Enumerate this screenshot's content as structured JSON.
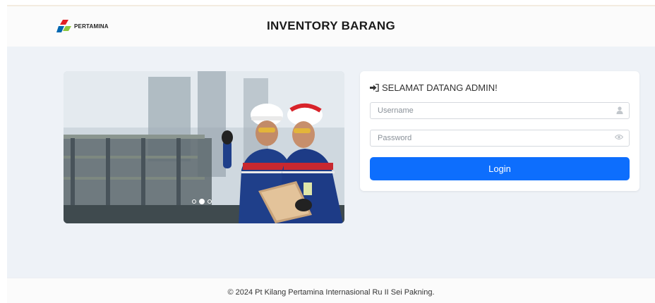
{
  "header": {
    "logo_text": "PERTAMINA",
    "title": "INVENTORY BARANG"
  },
  "carousel": {
    "image_icon": "pertamina-workers-photo",
    "slide_count": 3,
    "active_slide": 2
  },
  "login": {
    "title_icon": "sign-in-icon",
    "title": "SELAMAT DATANG ADMIN!",
    "username_placeholder": "Username",
    "username_value": "",
    "username_icon": "user-icon",
    "password_placeholder": "Password",
    "password_value": "",
    "password_icon": "eye-icon",
    "button_label": "Login"
  },
  "footer": {
    "text": "© 2024 Pt Kilang Pertamina Internasional Ru II Sei Pakning."
  },
  "colors": {
    "accent": "#0d6efd",
    "background": "#eef2f7",
    "logo_red": "#e31e24",
    "logo_blue": "#0067b1",
    "logo_green": "#8dc63f"
  }
}
